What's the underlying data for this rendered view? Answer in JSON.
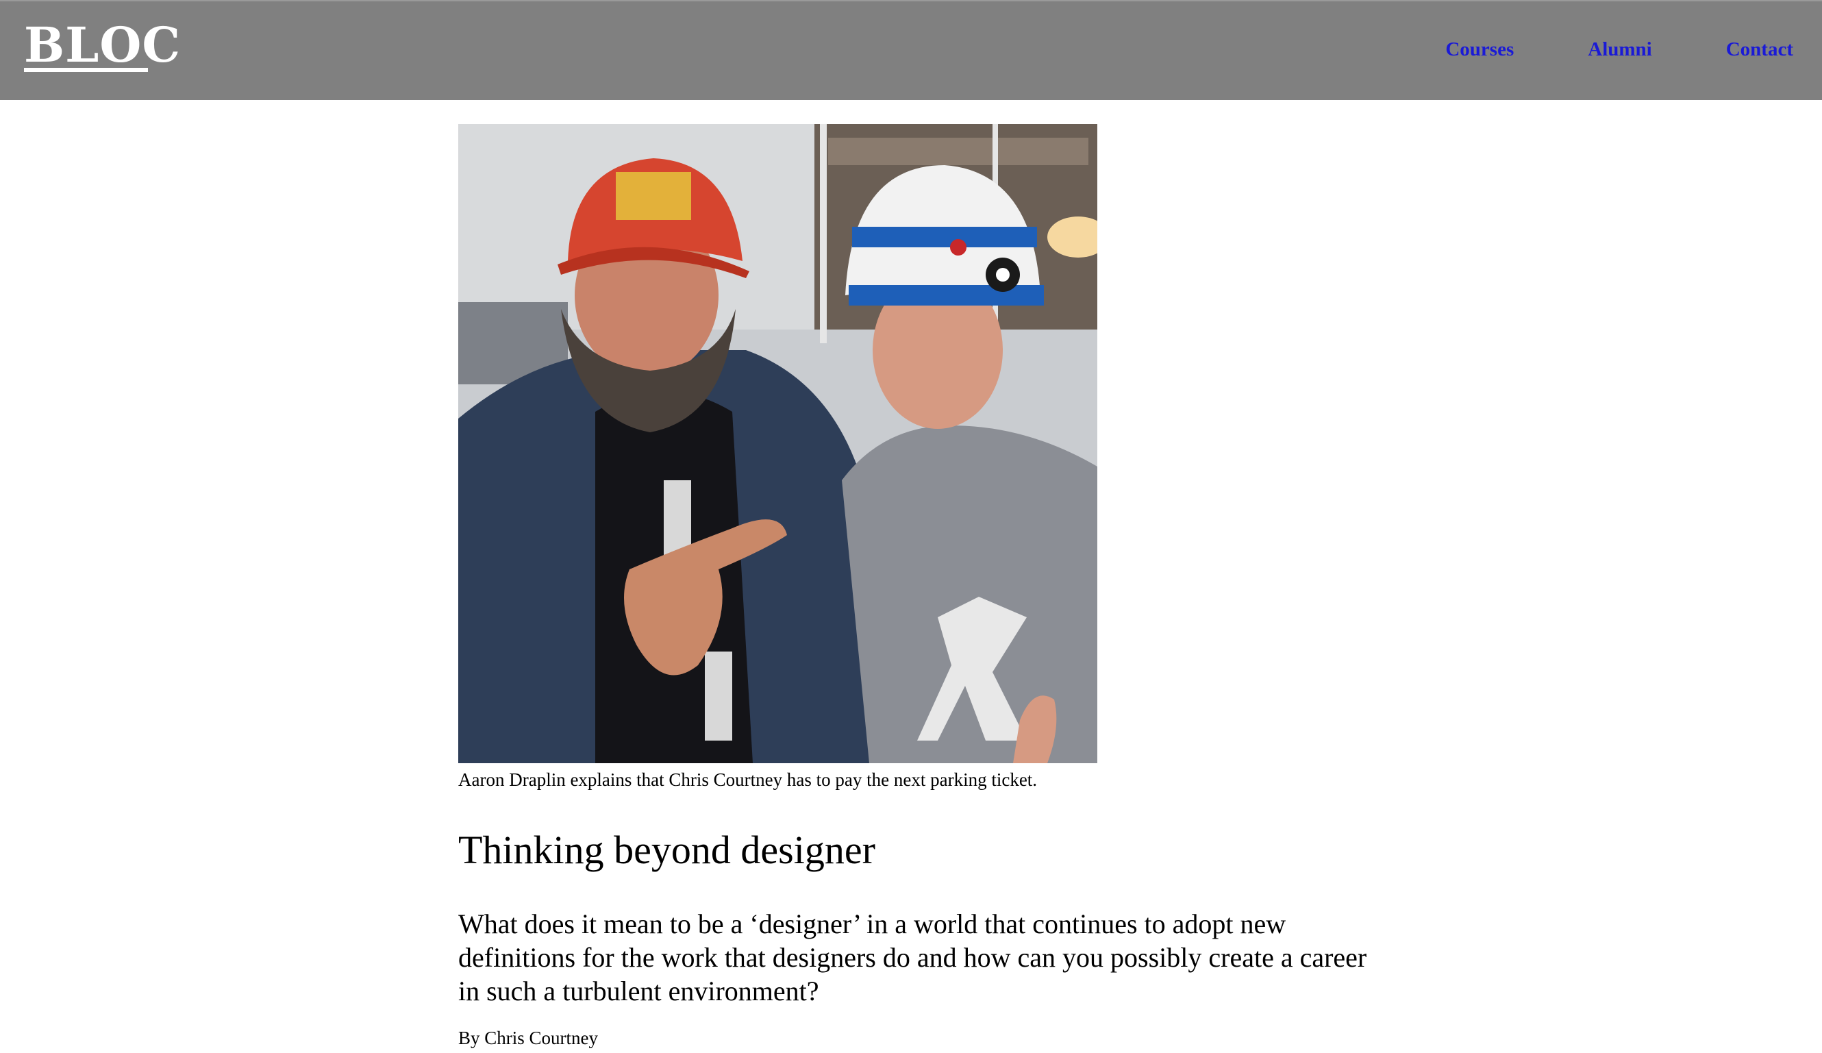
{
  "header": {
    "logo": "BLOC",
    "nav": [
      {
        "label": "Courses"
      },
      {
        "label": "Alumni"
      },
      {
        "label": "Contact"
      }
    ],
    "colors": {
      "background": "#808080",
      "link": "#1a1ad6"
    }
  },
  "article": {
    "photo_caption": "Aaron Draplin explains that Chris Courtney has to pay the next parking ticket.",
    "section_title": "Thinking beyond designer",
    "lead": "What does it mean to be a ‘designer’ in a world that continues to adopt new definitions for the work that designers do and how can you possibly create a career in such a turbulent environment?",
    "byline": "By Chris Courtney"
  }
}
